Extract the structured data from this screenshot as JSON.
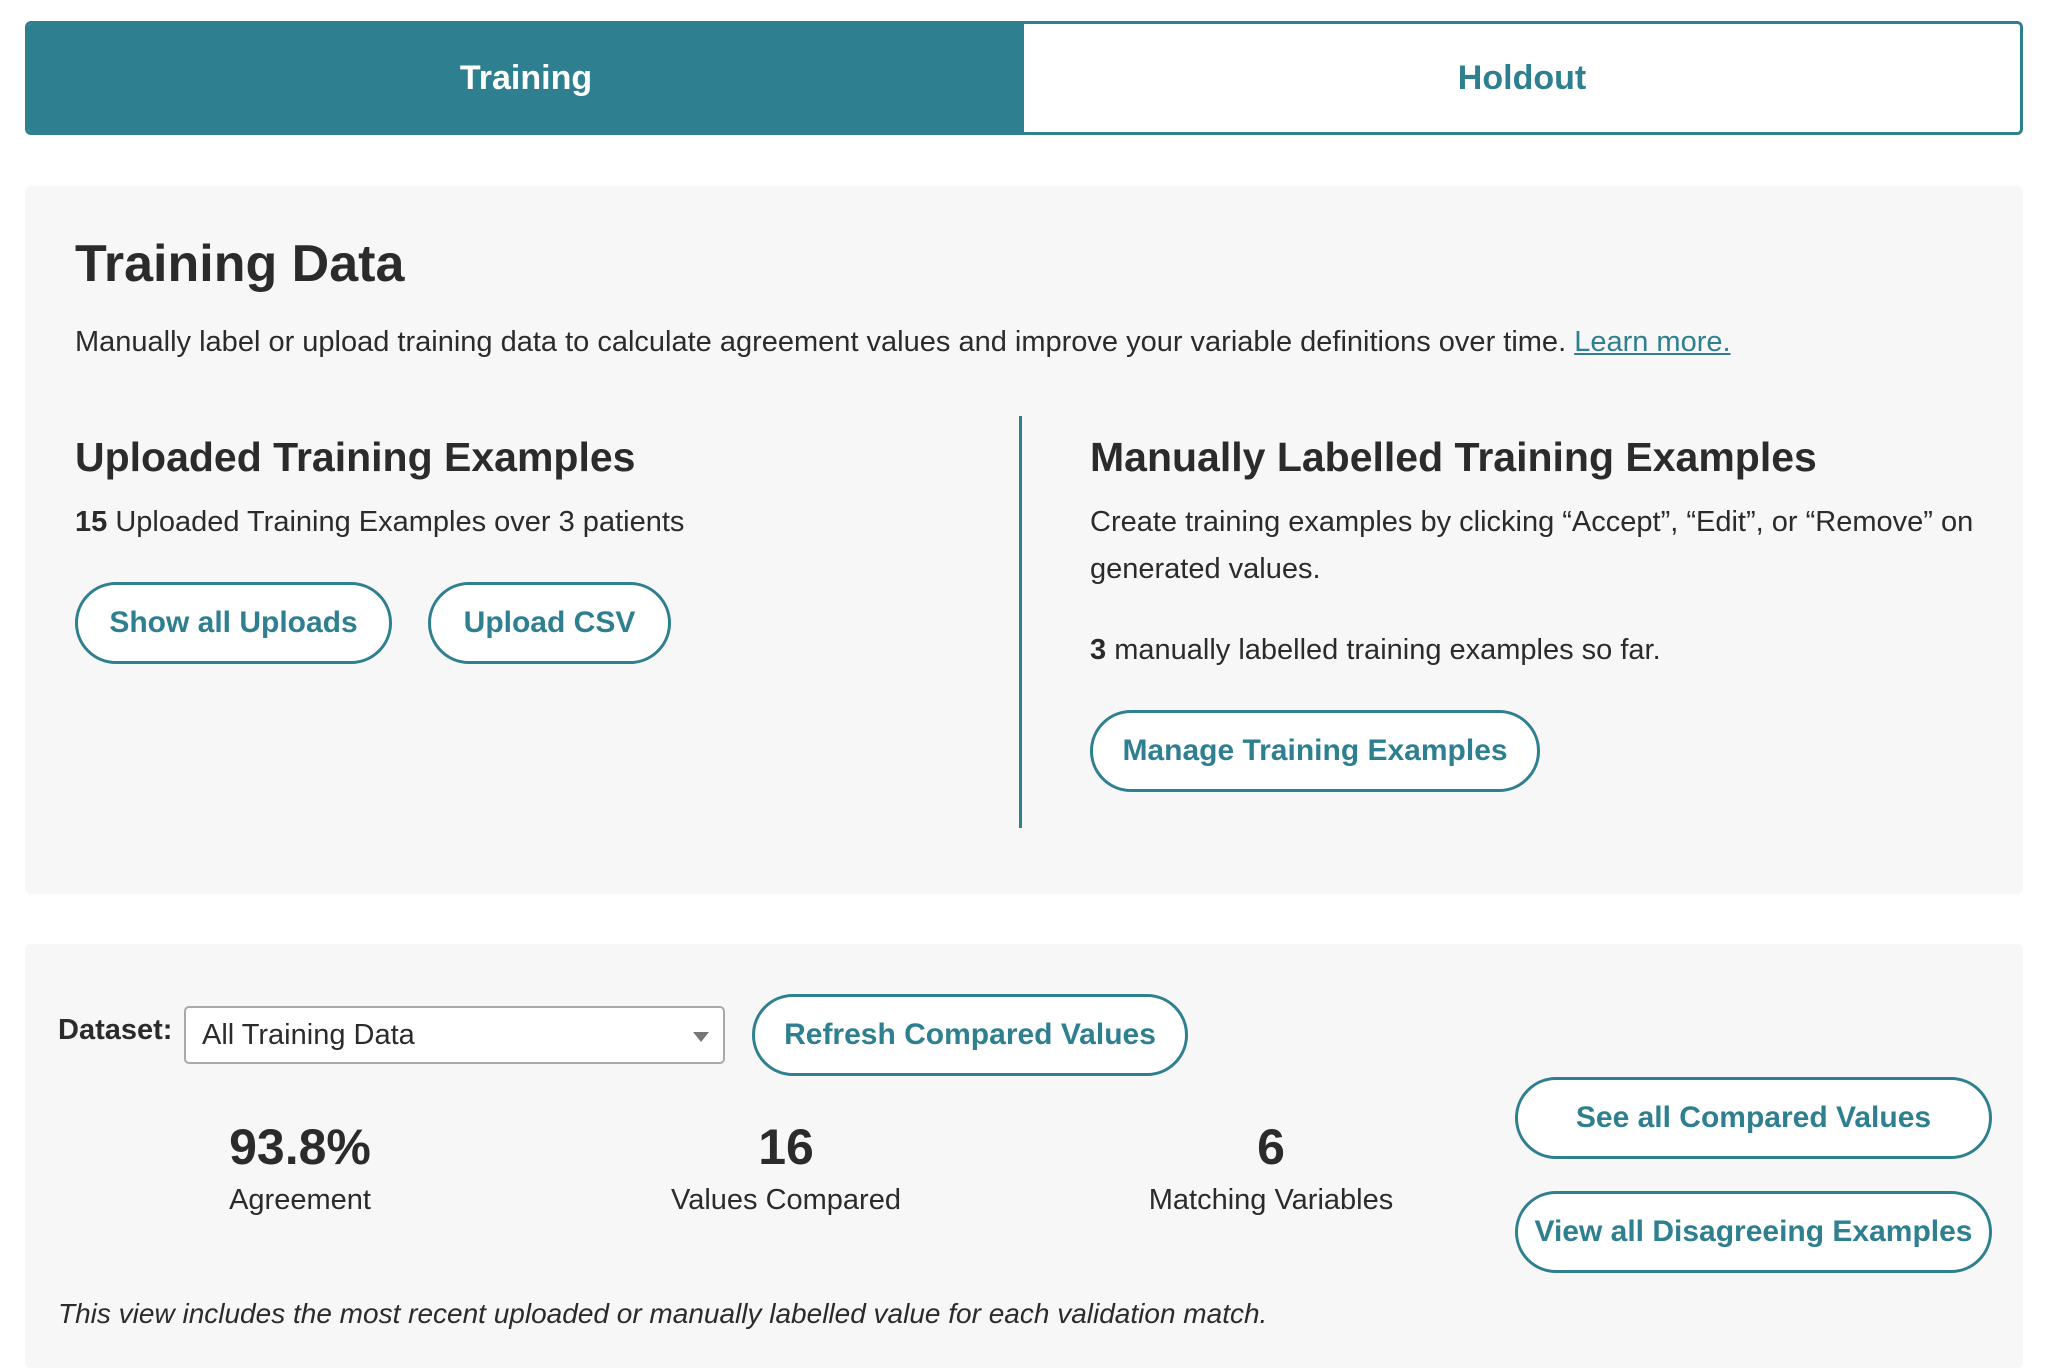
{
  "tabs": [
    {
      "label": "Training",
      "active": true
    },
    {
      "label": "Holdout",
      "active": false
    }
  ],
  "training_data": {
    "title": "Training Data",
    "intro": "Manually label or upload training data to calculate agreement values and improve your variable definitions over time.",
    "learn_more": "Learn more."
  },
  "uploaded": {
    "title": "Uploaded Training Examples",
    "count": "15",
    "summary_rest": "Uploaded Training Examples over 3 patients",
    "show_all_button": "Show all Uploads",
    "upload_button": "Upload CSV"
  },
  "manual": {
    "title": "Manually Labelled Training Examples",
    "description": "Create training examples by clicking “Accept”, “Edit”, or “Remove” on generated values.",
    "count": "3",
    "count_rest": "manually labelled training examples so far.",
    "manage_button": "Manage Training Examples"
  },
  "comparison": {
    "dataset_label": "Dataset:",
    "dataset_selected": "All Training Data",
    "refresh_button": "Refresh Compared Values",
    "stats": [
      {
        "value": "93.8%",
        "label": "Agreement"
      },
      {
        "value": "16",
        "label": "Values Compared"
      },
      {
        "value": "6",
        "label": "Matching Variables"
      }
    ],
    "see_all_button": "See all Compared Values",
    "view_disagreeing_button": "View all Disagreeing Examples",
    "footnote": "This view includes the most recent uploaded or manually labelled value for each validation match."
  },
  "colors": {
    "accent": "#2e7f8f",
    "panel_bg": "#f7f7f7",
    "text": "#2b2b2b"
  }
}
